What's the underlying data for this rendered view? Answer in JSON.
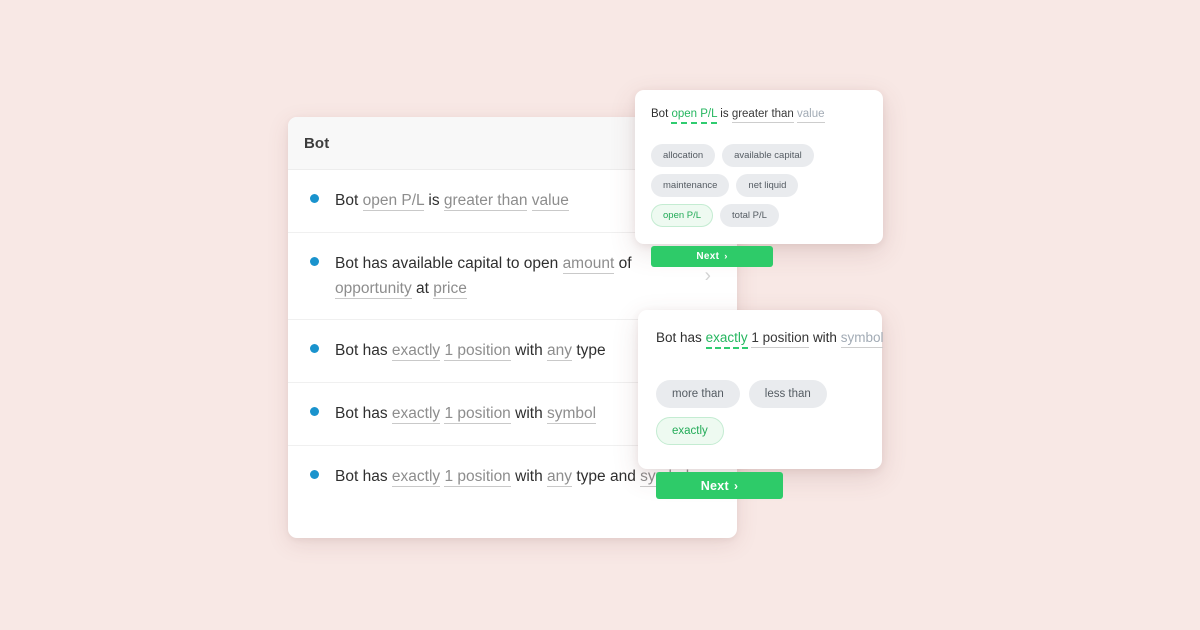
{
  "background_color": "#f8e8e5",
  "accent_colors": {
    "bullet_blue": "#1a93cd",
    "green": "#2ecb69",
    "green_text": "#23ab58",
    "chip_gray": "#e9ebee",
    "slot_gray": "#8d8d8d"
  },
  "bot_card": {
    "title": "Bot",
    "chevron_icon": "›",
    "rows": [
      {
        "id": "row-open-pl",
        "has_chevron": false,
        "tokens": [
          {
            "text": "Bot",
            "type": "plain"
          },
          {
            "text": "open P/L",
            "type": "slot"
          },
          {
            "text": "is",
            "type": "plain"
          },
          {
            "text": "greater than",
            "type": "slot"
          },
          {
            "text": "value",
            "type": "slot"
          }
        ]
      },
      {
        "id": "row-available-capital",
        "has_chevron": true,
        "tokens": [
          {
            "text": "Bot",
            "type": "plain"
          },
          {
            "text": "has",
            "type": "plain"
          },
          {
            "text": "available",
            "type": "plain"
          },
          {
            "text": "capital",
            "type": "plain"
          },
          {
            "text": "to",
            "type": "plain"
          },
          {
            "text": "open",
            "type": "plain"
          },
          {
            "text": "amount",
            "type": "slot"
          },
          {
            "text": "of",
            "type": "plain"
          },
          {
            "text": "opportunity",
            "type": "slot"
          },
          {
            "text": "at",
            "type": "plain"
          },
          {
            "text": "price",
            "type": "slot"
          }
        ]
      },
      {
        "id": "row-exactly-any-type",
        "has_chevron": false,
        "tokens": [
          {
            "text": "Bot",
            "type": "plain"
          },
          {
            "text": "has",
            "type": "plain"
          },
          {
            "text": "exactly",
            "type": "slot"
          },
          {
            "text": "1 position",
            "type": "slot"
          },
          {
            "text": "with",
            "type": "plain"
          },
          {
            "text": "any",
            "type": "slot"
          },
          {
            "text": "type",
            "type": "plain"
          }
        ]
      },
      {
        "id": "row-exactly-symbol",
        "has_chevron": false,
        "tokens": [
          {
            "text": "Bot",
            "type": "plain"
          },
          {
            "text": "has",
            "type": "plain"
          },
          {
            "text": "exactly",
            "type": "slot"
          },
          {
            "text": "1 position",
            "type": "slot"
          },
          {
            "text": "with",
            "type": "plain"
          },
          {
            "text": "symbol",
            "type": "slot"
          }
        ]
      },
      {
        "id": "row-exactly-any-type-and-symbol",
        "has_chevron": true,
        "tokens": [
          {
            "text": "Bot",
            "type": "plain"
          },
          {
            "text": "has",
            "type": "plain"
          },
          {
            "text": "exactly",
            "type": "slot"
          },
          {
            "text": "1 position",
            "type": "slot"
          },
          {
            "text": "with",
            "type": "plain"
          },
          {
            "text": "any",
            "type": "slot"
          },
          {
            "text": "type",
            "type": "plain"
          },
          {
            "text": "and",
            "type": "plain"
          },
          {
            "text": "symbol",
            "type": "slot"
          }
        ]
      }
    ]
  },
  "popover_open_pl": {
    "sentence": [
      {
        "text": "Bot",
        "type": "plain"
      },
      {
        "text": "open P/L",
        "type": "selected"
      },
      {
        "text": "is",
        "type": "plain"
      },
      {
        "text": "greater than",
        "type": "underline"
      },
      {
        "text": "value",
        "type": "underline-light"
      }
    ],
    "chips": [
      {
        "label": "allocation",
        "selected": false
      },
      {
        "label": "available capital",
        "selected": false
      },
      {
        "label": "maintenance",
        "selected": false
      },
      {
        "label": "net liquid",
        "selected": false
      },
      {
        "label": "open P/L",
        "selected": true
      },
      {
        "label": "total P/L",
        "selected": false
      }
    ],
    "next_label": "Next",
    "next_arrow": "›"
  },
  "popover_exactly": {
    "sentence": [
      {
        "text": "Bot",
        "type": "plain"
      },
      {
        "text": "has",
        "type": "plain"
      },
      {
        "text": "exactly",
        "type": "selected"
      },
      {
        "text": "1 position",
        "type": "underline"
      },
      {
        "text": "with",
        "type": "plain"
      },
      {
        "text": "symbol",
        "type": "underline-light"
      }
    ],
    "chips": [
      {
        "label": "more than",
        "selected": false
      },
      {
        "label": "less than",
        "selected": false
      },
      {
        "label": "exactly",
        "selected": true
      }
    ],
    "next_label": "Next",
    "next_arrow": "›"
  }
}
